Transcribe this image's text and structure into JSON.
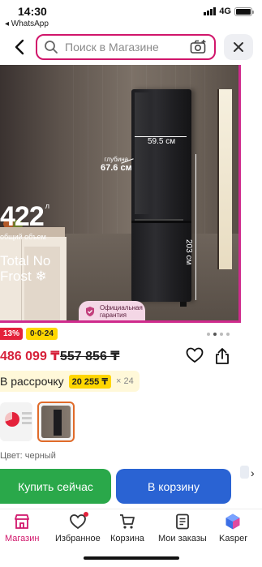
{
  "status": {
    "time": "14:30",
    "back_app": "◂ WhatsApp",
    "network": "4G"
  },
  "search": {
    "placeholder": "Поиск в Магазине"
  },
  "hero": {
    "volume": "422",
    "volume_unit": "л",
    "volume_label": "общий объем",
    "nofrost_line1": "Total No",
    "nofrost_line2": "Frost ❄",
    "width": "59.5 см",
    "height": "203 см",
    "depth_label": "глубина",
    "depth": "67.6 см",
    "warranty_line1": "Официальная",
    "warranty_line2": "гарантия",
    "slides": 4,
    "active_slide": 1
  },
  "product": {
    "discount": "13%",
    "installment_tag": "0·0·24",
    "price": "486 099 ₸",
    "old_price": "557 856 ₸",
    "installment_label": "В рассрочку",
    "installment_amount": "20 255 ₸",
    "installment_months": "× 24",
    "color_label": "Цвет: черный"
  },
  "actions": {
    "buy_now": "Купить сейчас",
    "add_to_cart": "В корзину"
  },
  "tabs": [
    {
      "label": "Магазин",
      "icon": "store-icon",
      "active": true
    },
    {
      "label": "Избранное",
      "icon": "heart-icon",
      "active": false
    },
    {
      "label": "Корзина",
      "icon": "cart-icon",
      "active": false
    },
    {
      "label": "Мои заказы",
      "icon": "orders-icon",
      "active": false
    },
    {
      "label": "Kasper",
      "icon": "kasper-icon",
      "active": false
    }
  ],
  "colors": {
    "accent": "#d1166b",
    "buy": "#2aa84a",
    "cart": "#2a63d3",
    "price": "#d6213a",
    "highlight": "#ffd600"
  }
}
